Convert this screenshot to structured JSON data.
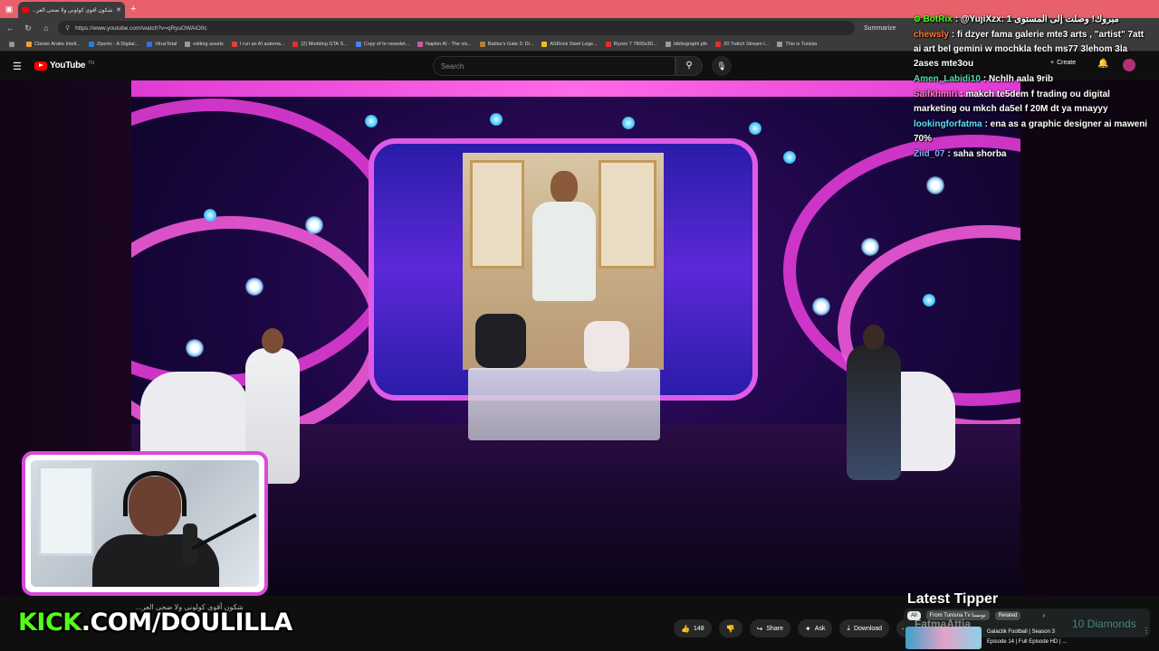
{
  "browser": {
    "tab_title": "شكون أقوى كولوني ولا ضحى العر...",
    "url": "https://www.youtube.com/watch?v=qRyuOWAiO0c",
    "summarize_label": "Summarize",
    "bookmarks": [
      {
        "label": "Clavier Arabe Intell...",
        "color": "#f29b38"
      },
      {
        "label": "Ziperto - A Digital...",
        "color": "#2a7fd4"
      },
      {
        "label": "VirusTotal",
        "color": "#3b6fe0"
      },
      {
        "label": "editing assets",
        "color": "#9a9a9a"
      },
      {
        "label": "I run an AI automa...",
        "color": "#e04040"
      },
      {
        "label": "(2) Modding GTA S...",
        "color": "#e03030"
      },
      {
        "label": "Copy of hr-newslet...",
        "color": "#4a84e8"
      },
      {
        "label": "Napkin AI - The vis...",
        "color": "#c85aa8"
      },
      {
        "label": "Baldur's Gate 3: Di...",
        "color": "#b08040"
      },
      {
        "label": "ASRock Steel Lege...",
        "color": "#e8c020"
      },
      {
        "label": "Ryzen 7 7800x3D...",
        "color": "#e03030"
      },
      {
        "label": "bibliographi pfe",
        "color": "#9a9a9a"
      },
      {
        "label": "20 Twitch Stream I...",
        "color": "#e03030"
      },
      {
        "label": "This is Tunisia",
        "color": "#9a9a9a"
      }
    ]
  },
  "youtube": {
    "logo_text": "YouTube",
    "logo_country": "TN",
    "search_placeholder": "Search",
    "create_label": "Create",
    "actions": {
      "like_count": "148",
      "share_label": "Share",
      "ask_label": "Ask",
      "download_label": "Download"
    },
    "chips": [
      "All",
      "From Tunisna Tv تونسنا",
      "Related"
    ],
    "related": {
      "title_line1": "Galactik Football | Season 3",
      "title_line2": "Episode 14 | Full Episode HD | ..."
    }
  },
  "chat": [
    {
      "user": "BotRix",
      "user_color": "#53fc18",
      "message": "@YujiXzx: مبروك! وصلت إلى المستوى 1",
      "badges": true
    },
    {
      "user": "chewsly",
      "user_color": "#ff7a3c",
      "message": "fi dzyer fama galerie mte3 arts , \"artist\" 7att ai art bel gemini w mochkla fech ms77 3lehom 3la 2ases mte3ou",
      "badges": false
    },
    {
      "user": "Amen_Labidi10",
      "user_color": "#4be0a0",
      "message": "Nchlh aala 9rib",
      "badges": false
    },
    {
      "user": "Saifkhmiri",
      "user_color": "#ff7ac8",
      "message": "makch te5dem f trading ou digital marketing ou mkch da5el f 20M dt ya mnayyy",
      "badges": false
    },
    {
      "user": "lookingforfatma",
      "user_color": "#5ee0ff",
      "message": "ena as a graphic designer ai maweni 70%",
      "badges": false
    },
    {
      "user": "Ziid_07",
      "user_color": "#8aa8ff",
      "message": "saha shorba",
      "badges": false
    }
  ],
  "overlay": {
    "webcam_caption": "شكون أقوى كولوني ولا ضحى العر...",
    "kick_prefix": "KICK",
    "kick_rest": ".COM/DOULILLA",
    "latest_tipper_label": "Latest Tipper",
    "tipper_name": "FatmaAttia",
    "tipper_amount": "10 Diamonds"
  },
  "colors": {
    "accent_pink": "#d94ad6",
    "kick_green": "#53fc18",
    "tab_bar": "#e8606a"
  }
}
